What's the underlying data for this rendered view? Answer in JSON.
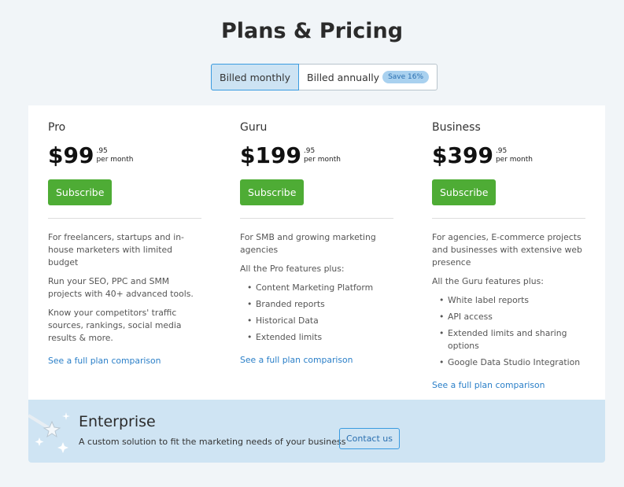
{
  "title": "Plans & Pricing",
  "billing": {
    "monthly": "Billed monthly",
    "annually": "Billed annually",
    "save_badge": "Save 16%"
  },
  "plans": [
    {
      "name": "Pro",
      "price": "$99",
      "cents": ".95",
      "period": "per month",
      "cta": "Subscribe",
      "paras": [
        "For freelancers, startups and in-house marketers with limited budget",
        "Run your SEO, PPC and SMM projects with 40+ advanced tools.",
        "Know your competitors' traffic sources, rankings, social media results & more."
      ],
      "features": [],
      "link": "See a full plan comparison"
    },
    {
      "name": "Guru",
      "price": "$199",
      "cents": ".95",
      "period": "per month",
      "cta": "Subscribe",
      "paras": [
        "For SMB and growing marketing agencies",
        "All the Pro features plus:"
      ],
      "features": [
        "Content Marketing Platform",
        "Branded reports",
        "Historical Data",
        "Extended limits"
      ],
      "link": "See a full plan comparison"
    },
    {
      "name": "Business",
      "price": "$399",
      "cents": ".95",
      "period": "per month",
      "cta": "Subscribe",
      "paras": [
        "For agencies, E-commerce projects and businesses with extensive web presence",
        "All the Guru features plus:"
      ],
      "features": [
        "White label reports",
        "API access",
        "Extended limits and sharing options",
        "Google Data Studio Integration"
      ],
      "link": "See a full plan comparison"
    }
  ],
  "enterprise": {
    "title": "Enterprise",
    "description": "A custom solution to fit the marketing needs of your business",
    "cta": "Contact us",
    "icon": "magic-wand-icon"
  }
}
